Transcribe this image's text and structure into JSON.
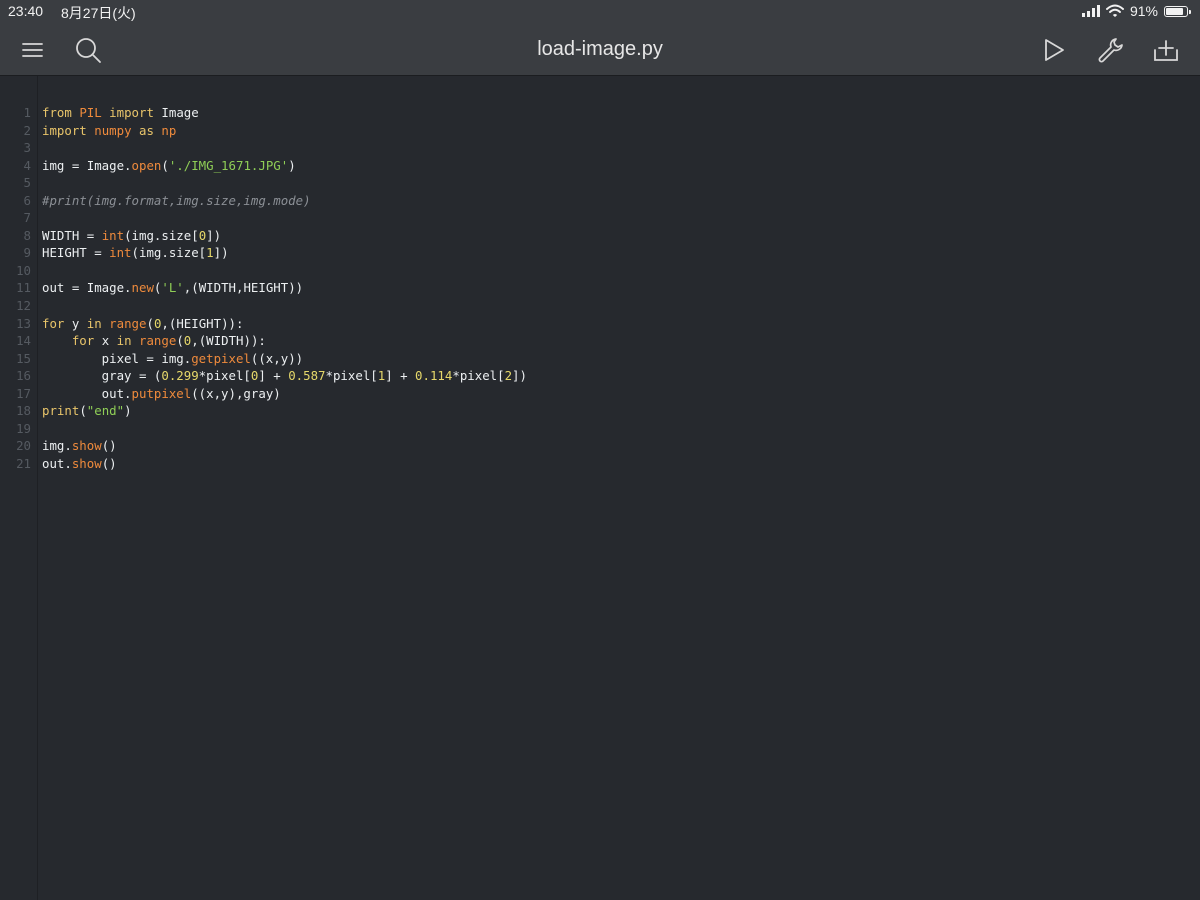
{
  "status_bar": {
    "time": "23:40",
    "date": "8月27日(火)",
    "battery_percent": "91%",
    "battery_level": 0.91
  },
  "toolbar": {
    "title": "load-image.py",
    "icons": [
      "menu-icon",
      "search-icon",
      "run-icon",
      "wrench-icon",
      "add-icon"
    ]
  },
  "editor": {
    "lines": [
      {
        "num": "1",
        "tokens": [
          {
            "t": "from",
            "c": "kw"
          },
          {
            "t": " "
          },
          {
            "t": "PIL",
            "c": "mod"
          },
          {
            "t": " "
          },
          {
            "t": "import",
            "c": "kw"
          },
          {
            "t": " Image"
          }
        ]
      },
      {
        "num": "2",
        "tokens": [
          {
            "t": "import",
            "c": "kw"
          },
          {
            "t": " "
          },
          {
            "t": "numpy",
            "c": "mod"
          },
          {
            "t": " "
          },
          {
            "t": "as",
            "c": "kw"
          },
          {
            "t": " "
          },
          {
            "t": "np",
            "c": "mod"
          }
        ]
      },
      {
        "num": "3",
        "tokens": []
      },
      {
        "num": "4",
        "tokens": [
          {
            "t": "img = Image."
          },
          {
            "t": "open",
            "c": "fn"
          },
          {
            "t": "("
          },
          {
            "t": "'./IMG_1671.JPG'",
            "c": "str"
          },
          {
            "t": ")"
          }
        ]
      },
      {
        "num": "5",
        "tokens": []
      },
      {
        "num": "6",
        "tokens": [
          {
            "t": "#print(img.format,img.size,img.mode)",
            "c": "cmt"
          }
        ]
      },
      {
        "num": "7",
        "tokens": []
      },
      {
        "num": "8",
        "tokens": [
          {
            "t": "WIDTH = "
          },
          {
            "t": "int",
            "c": "fn"
          },
          {
            "t": "(img.size["
          },
          {
            "t": "0",
            "c": "numlit"
          },
          {
            "t": "])"
          }
        ]
      },
      {
        "num": "9",
        "tokens": [
          {
            "t": "HEIGHT = "
          },
          {
            "t": "int",
            "c": "fn"
          },
          {
            "t": "(img.size["
          },
          {
            "t": "1",
            "c": "numlit"
          },
          {
            "t": "])"
          }
        ]
      },
      {
        "num": "10",
        "tokens": []
      },
      {
        "num": "11",
        "tokens": [
          {
            "t": "out = Image."
          },
          {
            "t": "new",
            "c": "fn"
          },
          {
            "t": "("
          },
          {
            "t": "'L'",
            "c": "str"
          },
          {
            "t": ",(WIDTH,HEIGHT))"
          }
        ]
      },
      {
        "num": "12",
        "tokens": []
      },
      {
        "num": "13",
        "tokens": [
          {
            "t": "for",
            "c": "kw"
          },
          {
            "t": " y "
          },
          {
            "t": "in",
            "c": "kw"
          },
          {
            "t": " "
          },
          {
            "t": "range",
            "c": "fn"
          },
          {
            "t": "("
          },
          {
            "t": "0",
            "c": "numlit"
          },
          {
            "t": ",(HEIGHT)):"
          }
        ]
      },
      {
        "num": "14",
        "tokens": [
          {
            "t": "    "
          },
          {
            "t": "for",
            "c": "kw"
          },
          {
            "t": " x "
          },
          {
            "t": "in",
            "c": "kw"
          },
          {
            "t": " "
          },
          {
            "t": "range",
            "c": "fn"
          },
          {
            "t": "("
          },
          {
            "t": "0",
            "c": "numlit"
          },
          {
            "t": ",(WIDTH)):"
          }
        ]
      },
      {
        "num": "15",
        "tokens": [
          {
            "t": "        pixel = img."
          },
          {
            "t": "getpixel",
            "c": "fn"
          },
          {
            "t": "((x,y))"
          }
        ]
      },
      {
        "num": "16",
        "tokens": [
          {
            "t": "        gray = ("
          },
          {
            "t": "0.299",
            "c": "numlit"
          },
          {
            "t": "*pixel["
          },
          {
            "t": "0",
            "c": "numlit"
          },
          {
            "t": "] + "
          },
          {
            "t": "0.587",
            "c": "numlit"
          },
          {
            "t": "*pixel["
          },
          {
            "t": "1",
            "c": "numlit"
          },
          {
            "t": "] + "
          },
          {
            "t": "0.114",
            "c": "numlit"
          },
          {
            "t": "*pixel["
          },
          {
            "t": "2",
            "c": "numlit"
          },
          {
            "t": "])"
          }
        ]
      },
      {
        "num": "17",
        "tokens": [
          {
            "t": "        out."
          },
          {
            "t": "putpixel",
            "c": "fn"
          },
          {
            "t": "((x,y),gray)"
          }
        ]
      },
      {
        "num": "18",
        "tokens": [
          {
            "t": "print",
            "c": "kw"
          },
          {
            "t": "("
          },
          {
            "t": "\"end\"",
            "c": "str"
          },
          {
            "t": ")"
          }
        ]
      },
      {
        "num": "19",
        "tokens": []
      },
      {
        "num": "20",
        "tokens": [
          {
            "t": "img."
          },
          {
            "t": "show",
            "c": "fn"
          },
          {
            "t": "()"
          }
        ]
      },
      {
        "num": "21",
        "tokens": [
          {
            "t": "out."
          },
          {
            "t": "show",
            "c": "fn"
          },
          {
            "t": "()"
          }
        ]
      }
    ]
  }
}
